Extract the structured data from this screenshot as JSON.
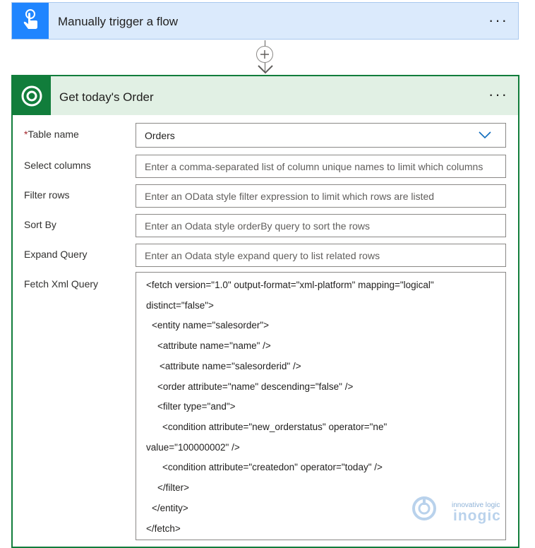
{
  "trigger": {
    "title": "Manually trigger a flow",
    "menu": "···",
    "icon": "touch-hand-icon"
  },
  "connector": {
    "add": "+"
  },
  "action": {
    "title": "Get today's Order",
    "menu": "···",
    "icon": "dataverse-icon",
    "fields": {
      "table_name": {
        "label": "Table name",
        "required": "*",
        "value": "Orders"
      },
      "select_columns": {
        "label": "Select columns",
        "placeholder": "Enter a comma-separated list of column unique names to limit which columns"
      },
      "filter_rows": {
        "label": "Filter rows",
        "placeholder": "Enter an OData style filter expression to limit which rows are listed"
      },
      "sort_by": {
        "label": "Sort By",
        "placeholder": "Enter an Odata style orderBy query to sort the rows"
      },
      "expand_query": {
        "label": "Expand Query",
        "placeholder": "Enter an Odata style expand query to list related rows"
      },
      "fetch_xml": {
        "label": "Fetch Xml Query",
        "lines": [
          "<fetch version=\"1.0\" output-format=\"xml-platform\" mapping=\"logical\"",
          "distinct=\"false\">",
          "  <entity name=\"salesorder\">",
          "    <attribute name=\"name\" />",
          "     <attribute name=\"salesorderid\" />",
          "    <order attribute=\"name\" descending=\"false\" />",
          "    <filter type=\"and\">",
          "      <condition attribute=\"new_orderstatus\" operator=\"ne\"",
          "value=\"100000002\" />",
          "      <condition attribute=\"createdon\" operator=\"today\" />",
          "    </filter>",
          "  </entity>",
          "</fetch>"
        ]
      }
    }
  },
  "watermark": {
    "tagline": "innovative logic",
    "brand": "inogic"
  }
}
